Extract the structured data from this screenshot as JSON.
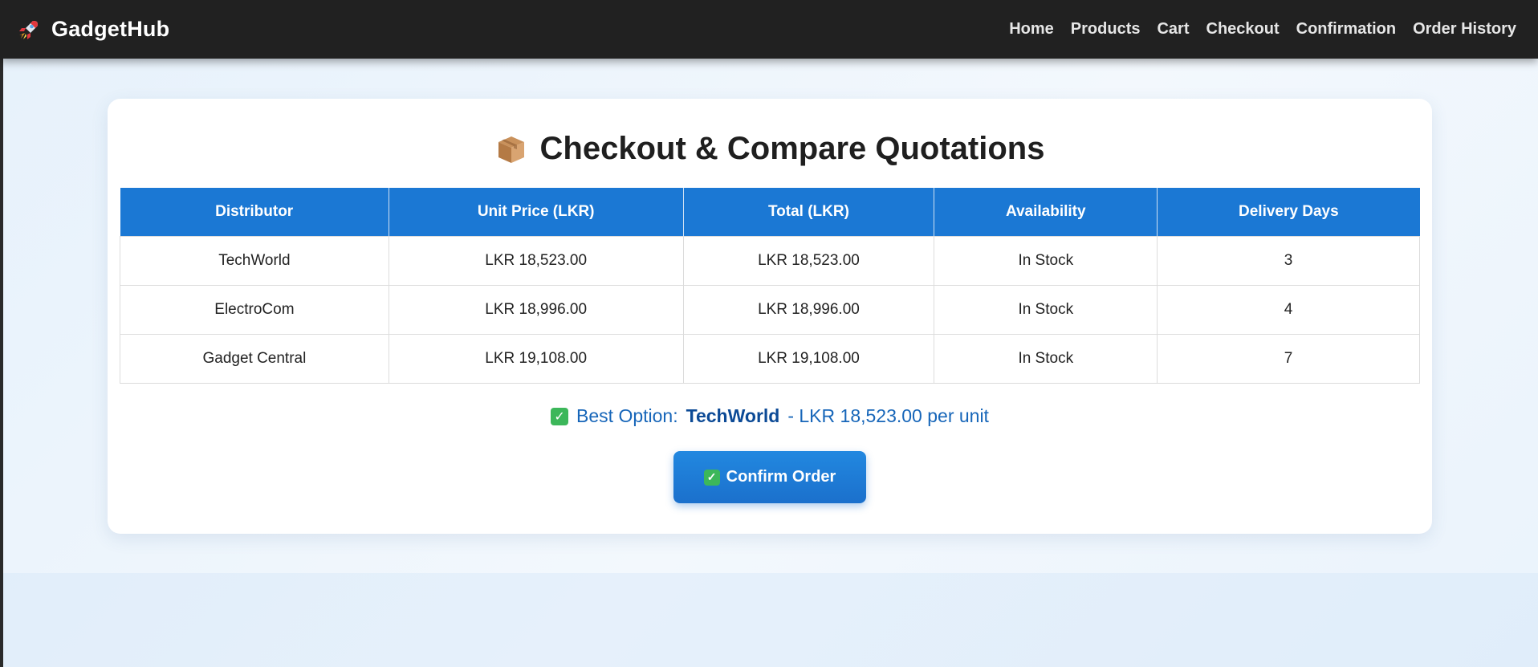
{
  "nav": {
    "brand": "GadgetHub",
    "brand_icon": "rocket-icon",
    "links": [
      "Home",
      "Products",
      "Cart",
      "Checkout",
      "Confirmation",
      "Order History"
    ]
  },
  "page": {
    "title": "Checkout & Compare Quotations",
    "title_icon": "package-icon"
  },
  "table": {
    "headers": [
      "Distributor",
      "Unit Price (LKR)",
      "Total (LKR)",
      "Availability",
      "Delivery Days"
    ],
    "rows": [
      [
        "TechWorld",
        "LKR 18,523.00",
        "LKR 18,523.00",
        "In Stock",
        "3"
      ],
      [
        "ElectroCom",
        "LKR 18,996.00",
        "LKR 18,996.00",
        "In Stock",
        "4"
      ],
      [
        "Gadget Central",
        "LKR 19,108.00",
        "LKR 19,108.00",
        "In Stock",
        "7"
      ]
    ]
  },
  "best_option": {
    "prefix": "Best Option:",
    "distributor": "TechWorld",
    "suffix": "- LKR 18,523.00 per unit",
    "icon": "check-mark-icon"
  },
  "confirm_button": {
    "label": "Confirm Order",
    "icon": "check-mark-icon"
  },
  "colors": {
    "navbar": "#212121",
    "header": "#1b78d4",
    "accent_text": "#1766b9",
    "check": "#3cb75a"
  }
}
